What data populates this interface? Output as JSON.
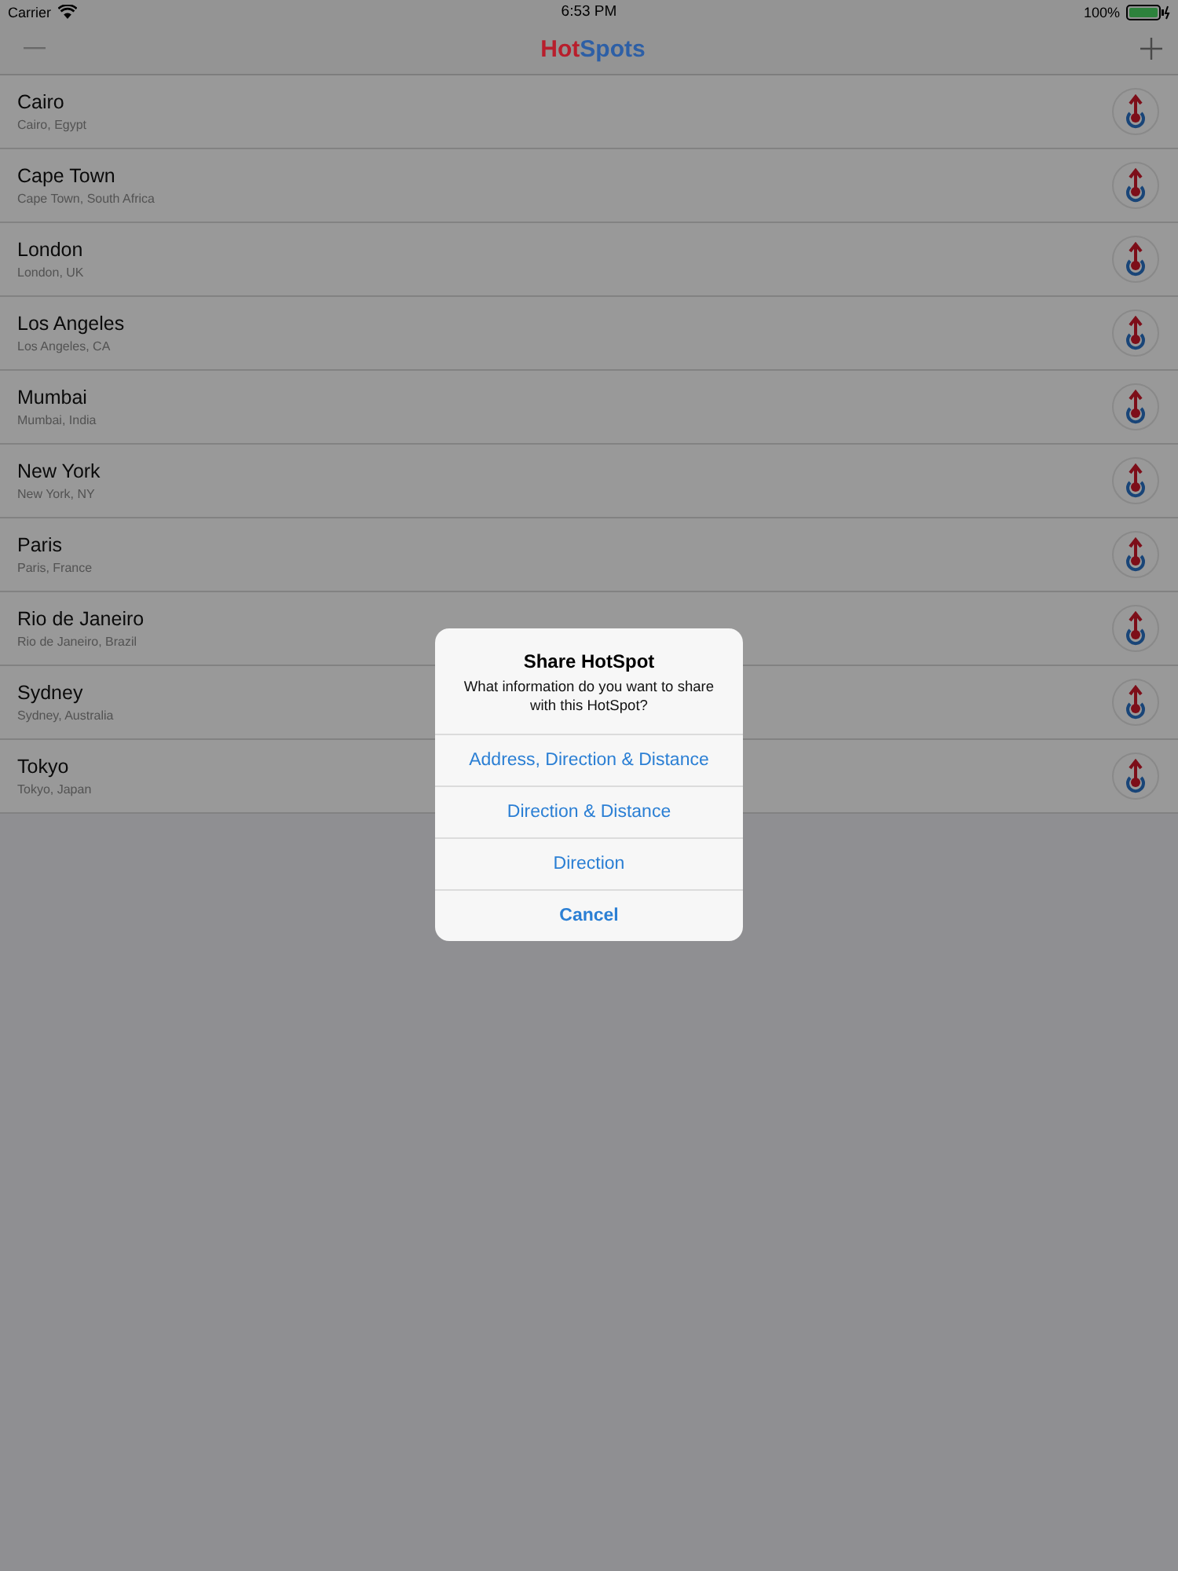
{
  "status_bar": {
    "carrier": "Carrier",
    "time": "6:53 PM",
    "battery": "100%"
  },
  "nav": {
    "title": [
      {
        "text": "Hot",
        "color": "#b81e2c"
      },
      {
        "text": "Spots",
        "color": "#2d5fa6"
      }
    ]
  },
  "places": [
    {
      "name": "Cairo",
      "detail": "Cairo, Egypt"
    },
    {
      "name": "Cape Town",
      "detail": "Cape Town, South Africa"
    },
    {
      "name": "London",
      "detail": "London, UK"
    },
    {
      "name": "Los Angeles",
      "detail": "Los Angeles, CA"
    },
    {
      "name": "Mumbai",
      "detail": "Mumbai, India"
    },
    {
      "name": "New York",
      "detail": "New York, NY"
    },
    {
      "name": "Paris",
      "detail": "Paris, France"
    },
    {
      "name": "Rio de Janeiro",
      "detail": "Rio de Janeiro, Brazil"
    },
    {
      "name": "Sydney",
      "detail": "Sydney, Australia"
    },
    {
      "name": "Tokyo",
      "detail": "Tokyo, Japan"
    }
  ],
  "alert": {
    "title": "Share HotSpot",
    "message": "What information do you want to share with this HotSpot?",
    "actions": [
      {
        "label": "Address, Direction & Distance",
        "kind": "default"
      },
      {
        "label": "Direction & Distance",
        "kind": "default"
      },
      {
        "label": "Direction",
        "kind": "default"
      },
      {
        "label": "Cancel",
        "kind": "cancel"
      }
    ]
  }
}
